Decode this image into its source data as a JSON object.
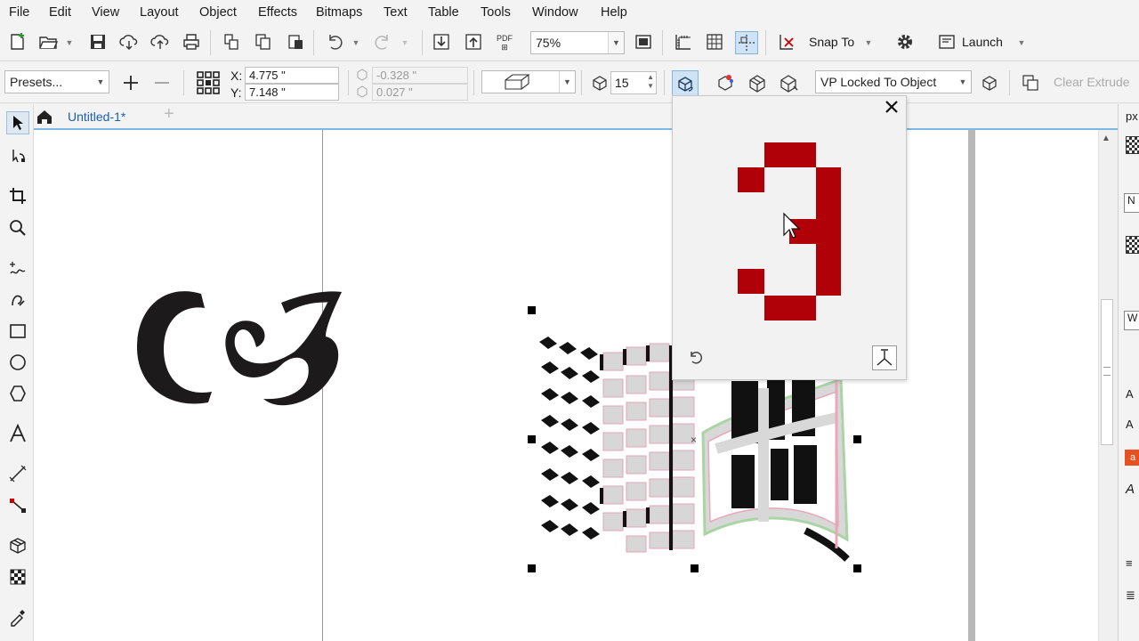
{
  "menu": [
    "File",
    "Edit",
    "View",
    "Layout",
    "Object",
    "Effects",
    "Bitmaps",
    "Text",
    "Table",
    "Tools",
    "Window",
    "Help"
  ],
  "toolbar": {
    "zoom": "75%",
    "pdf_label": "PDF",
    "snap_to": "Snap To",
    "launch": "Launch"
  },
  "property_bar": {
    "presets": "Presets...",
    "x_label": "X:",
    "x_value": "4.775 \"",
    "y_label": "Y:",
    "y_value": "7.148 \"",
    "vp_x": "-0.328 \"",
    "vp_y": "0.027 \"",
    "depth": "15",
    "vp_mode": "VP Locked To Object",
    "clear_extrude": "Clear Extrude"
  },
  "tabs": {
    "document": "Untitled-1*",
    "add": "+"
  },
  "docker": {
    "labels": [
      "px",
      "N",
      "W"
    ]
  },
  "canvas": {
    "ornament_glyph": "ƆB"
  },
  "colors": {
    "accent": "#7fb7e0",
    "extrude_red": "#b00008",
    "selection_handle": "#000000"
  }
}
